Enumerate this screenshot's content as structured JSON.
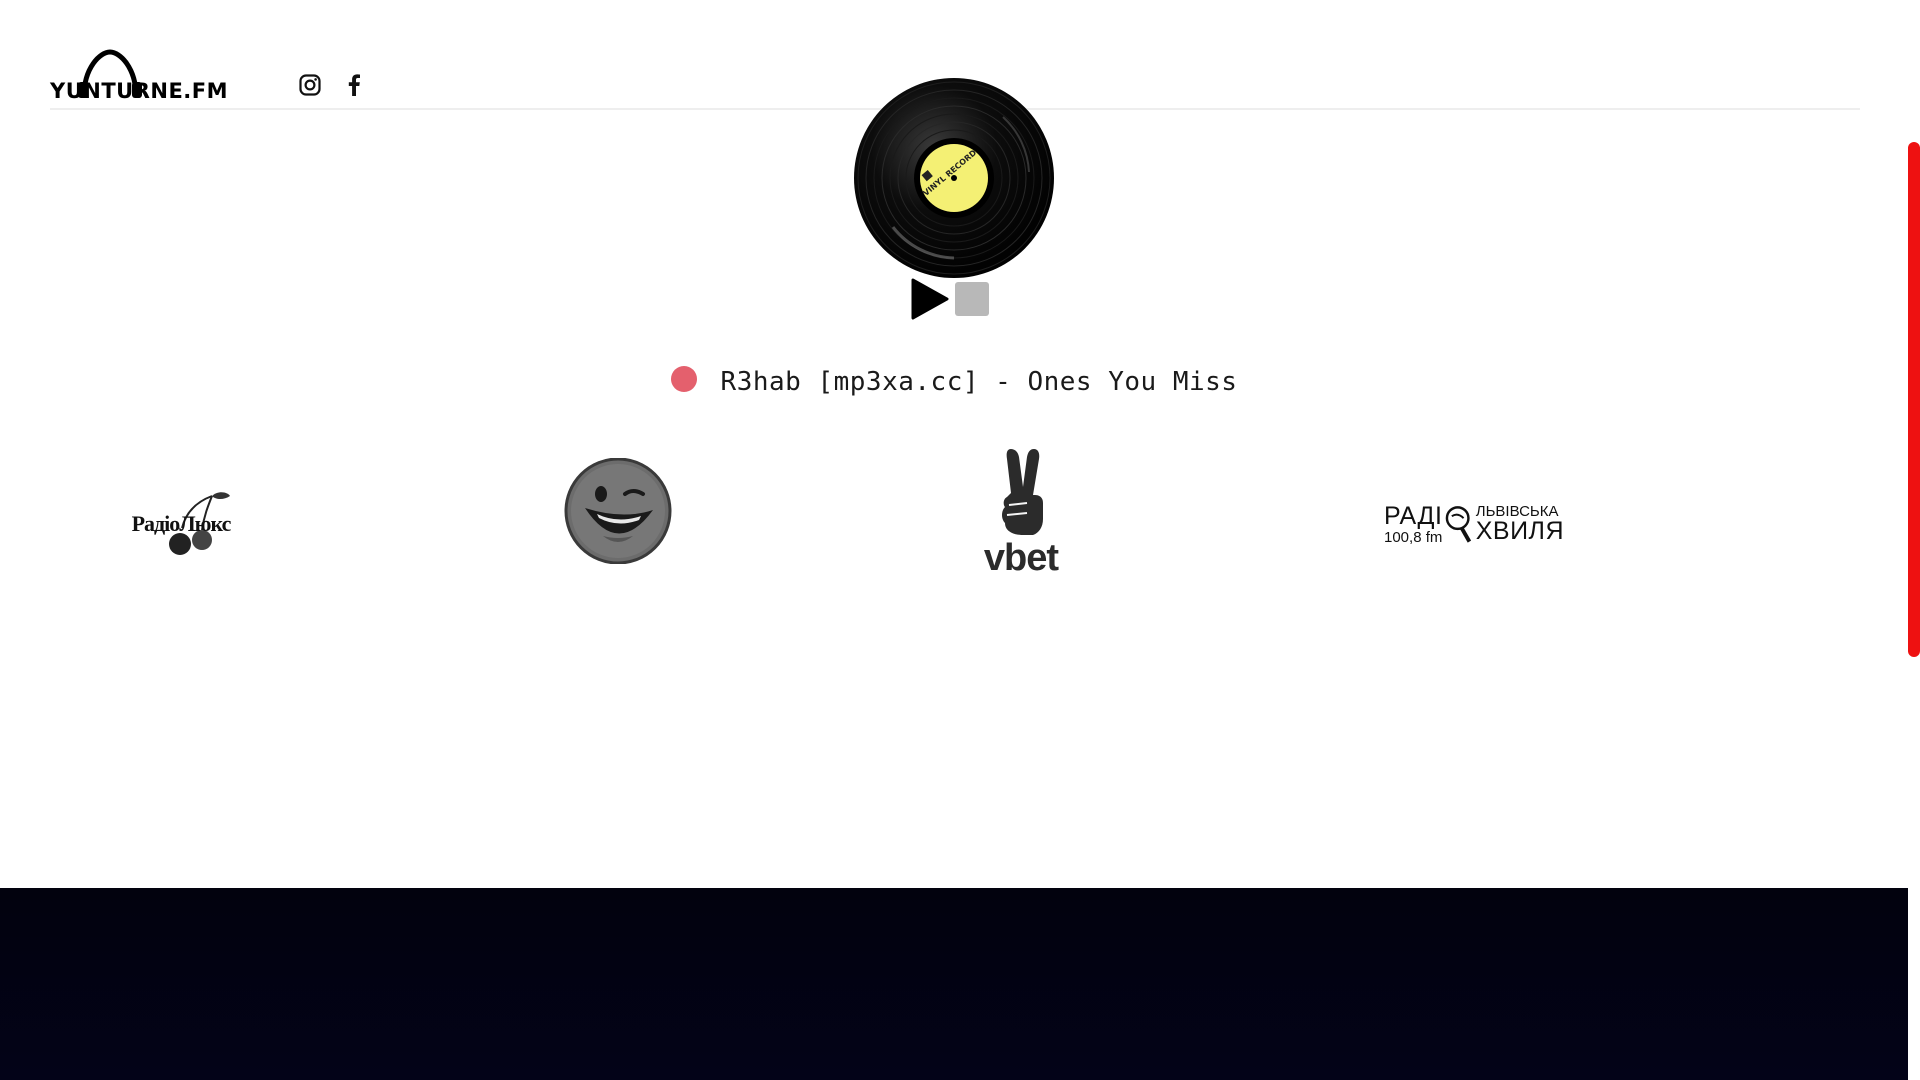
{
  "header": {
    "logo_text": "YUNTURNE.FM",
    "social": [
      {
        "name": "instagram-icon"
      },
      {
        "name": "facebook-icon"
      }
    ]
  },
  "player": {
    "record_label_text": "VINYL RECORD",
    "play_icon": "play-triangle",
    "stop_icon": "stop-square",
    "now_playing": "R3hab [mp3xa.cc] - Ones You Miss",
    "live_indicator_color": "#e4606d"
  },
  "partners": {
    "lux": {
      "text": "РадіоЛюкс"
    },
    "smile": {
      "icon": "winking-smiley-icon"
    },
    "vbet": {
      "text": "vbet",
      "icon": "victory-hand-icon"
    },
    "hvylia": {
      "radio": "РАДІ",
      "freq": "100,8 fm",
      "city": "ЛЬВІВСЬКА",
      "name": "ХВИЛЯ"
    }
  },
  "colors": {
    "scrollbar_thumb": "#ee1111",
    "footer_bg": "#02020e",
    "record_label": "#f4f074"
  }
}
